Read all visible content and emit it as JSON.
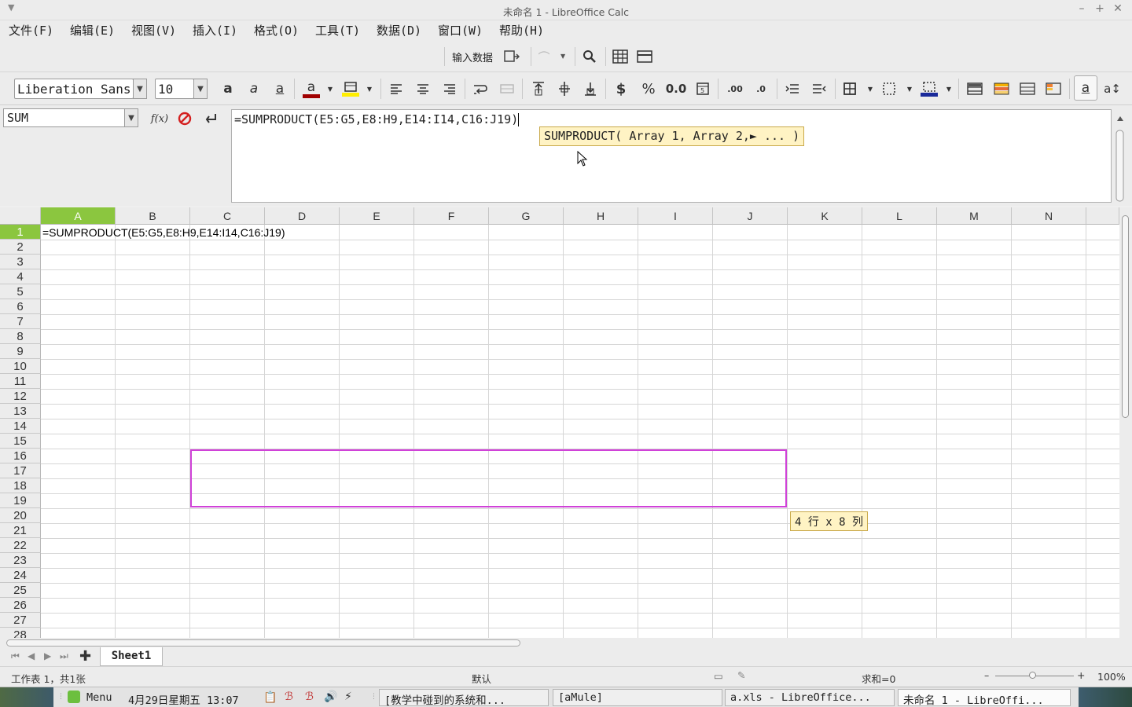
{
  "window": {
    "title": "未命名 1 - LibreOffice Calc"
  },
  "menu": [
    "文件(F)",
    "编辑(E)",
    "视图(V)",
    "插入(I)",
    "格式(O)",
    "工具(T)",
    "数据(D)",
    "窗口(W)",
    "帮助(H)"
  ],
  "toolbar1": {
    "input_mode_label": "输入数据"
  },
  "toolbar2": {
    "font_name": "Liberation Sans",
    "font_size": "10",
    "currency": "$",
    "percent": "%",
    "number_format": "0.0"
  },
  "formula_bar": {
    "name_box": "SUM",
    "fx_label": "f(x)",
    "content": "=SUMPRODUCT(E5:G5,E8:H9,E14:I14,C16:J19)",
    "tooltip": "SUMPRODUCT( Array 1, Array 2,► ...  )"
  },
  "columns": [
    "A",
    "B",
    "C",
    "D",
    "E",
    "F",
    "G",
    "H",
    "I",
    "J",
    "K",
    "L",
    "M",
    "N"
  ],
  "rows": [
    "1",
    "2",
    "3",
    "4",
    "5",
    "6",
    "7",
    "8",
    "9",
    "10",
    "11",
    "12",
    "13",
    "14",
    "15",
    "16",
    "17",
    "18",
    "19",
    "20",
    "21",
    "22",
    "23",
    "24",
    "25",
    "26",
    "27",
    "28"
  ],
  "cells": {
    "A1": "=SUMPRODUCT(E5:G5,E8:H9,E14:I14,C16:J19)"
  },
  "range_tooltip": "4 行 x 8 列",
  "sheet_tabs": [
    "Sheet1"
  ],
  "status_bar": {
    "sheet_info": "工作表 1，共1张",
    "page_style": "默认",
    "sum": "求和=0",
    "zoom": "100%"
  },
  "taskbar": {
    "menu_label": "Menu",
    "clock": "4月29日星期五 13:07",
    "windows": [
      "[教学中碰到的系统和...",
      "[aMule]",
      "a.xls - LibreOffice...",
      "未命名 1 - LibreOffi..."
    ]
  },
  "colors": {
    "selected_header": "#8bc63f",
    "range_border": "#d042d8",
    "tooltip_bg": "#fff3c4"
  }
}
